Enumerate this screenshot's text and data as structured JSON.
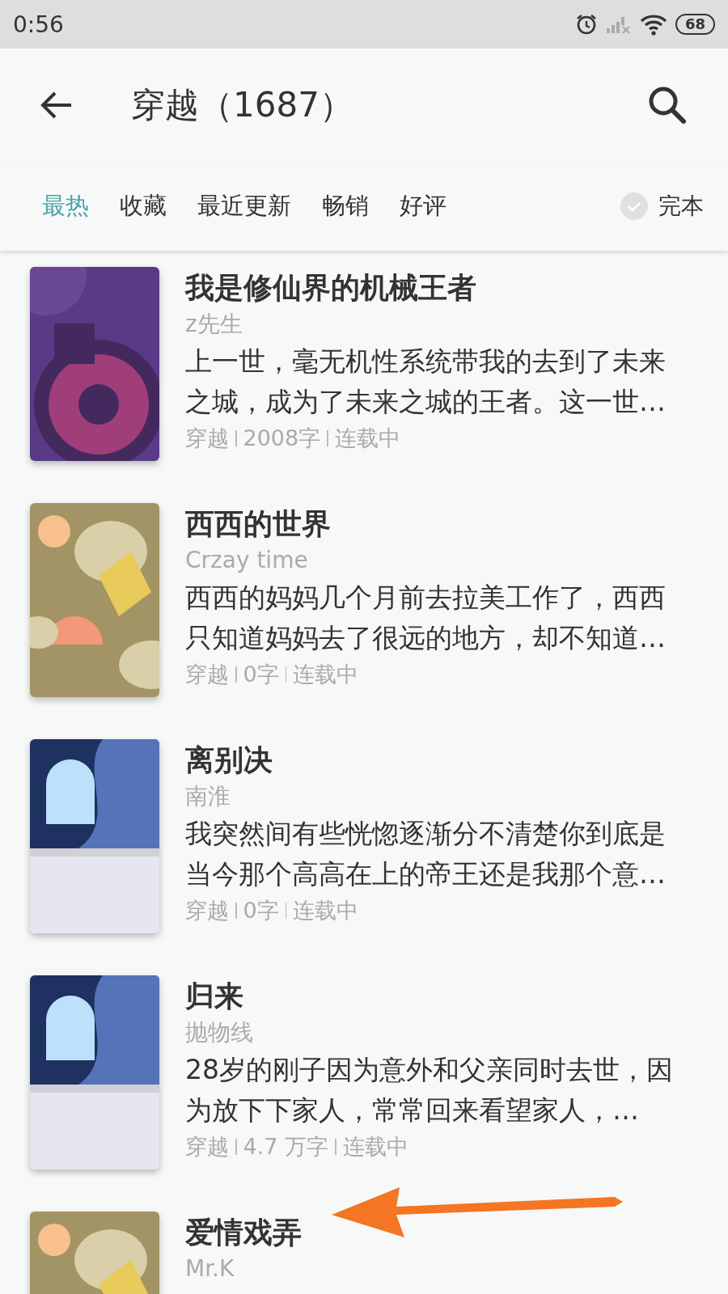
{
  "status_bar": {
    "time": "0:56",
    "battery": "68"
  },
  "header": {
    "title": "穿越（1687）"
  },
  "tabs": [
    {
      "label": "最热",
      "selected": true
    },
    {
      "label": "收藏",
      "selected": false
    },
    {
      "label": "最近更新",
      "selected": false
    },
    {
      "label": "畅销",
      "selected": false
    },
    {
      "label": "好评",
      "selected": false
    }
  ],
  "finished_filter": {
    "label": "完本",
    "checked": false
  },
  "books": [
    {
      "title": "我是修仙界的机械王者",
      "author": "z先生",
      "description": "上一世，毫无机性系统带我的去到了未来之城，成为了未来之城的王者。这一世…",
      "meta": [
        "穿越",
        "2008字",
        "连载中"
      ]
    },
    {
      "title": "西西的世界",
      "author": "Crzay time",
      "description": "西西的妈妈几个月前去拉美工作了，西西只知道妈妈去了很远的地方，却不知道…",
      "meta": [
        "穿越",
        "0字",
        "连载中"
      ]
    },
    {
      "title": "离别决",
      "author": "南淮",
      "description": "我突然间有些恍惚逐渐分不清楚你到底是当今那个高高在上的帝王还是我那个意…",
      "meta": [
        "穿越",
        "0字",
        "连载中"
      ]
    },
    {
      "title": "归来",
      "author": "抛物线",
      "description": "28岁的刚子因为意外和父亲同时去世，因为放下下家人，常常回来看望家人，…",
      "meta": [
        "穿越",
        "4.7 万字",
        "连载中"
      ]
    },
    {
      "title": "爱情戏弄",
      "author": "Mr.K"
    }
  ]
}
